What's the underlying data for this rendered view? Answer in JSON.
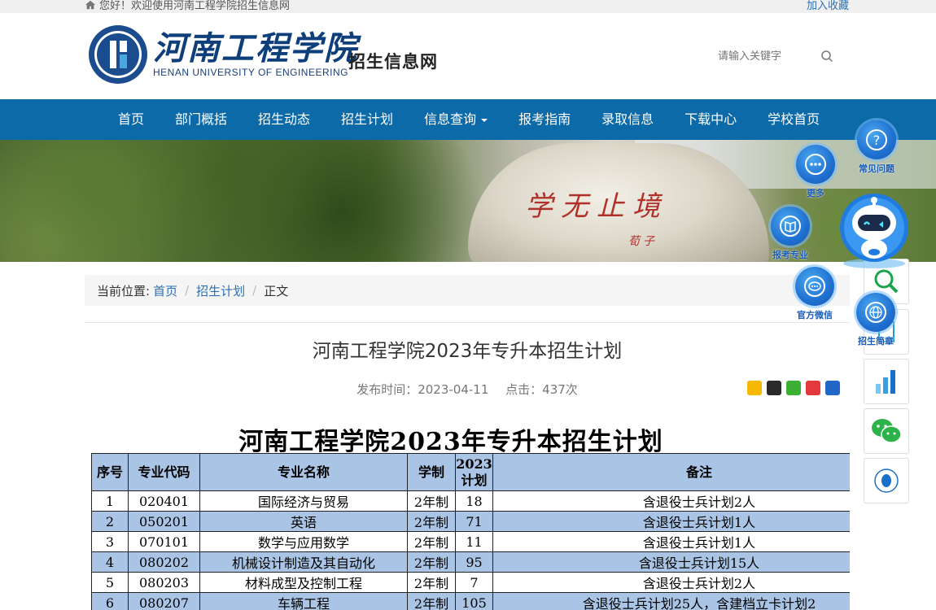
{
  "topbar": {
    "welcome": "您好！欢迎使用河南工程学院招生信息网",
    "favorite": "加入收藏"
  },
  "header": {
    "logo_cn": "河南工程学院",
    "logo_en": "HENAN UNIVERSITY OF ENGINEERING",
    "site_name": "招生信息网",
    "search_placeholder": "请输入关键字"
  },
  "nav": {
    "items": [
      "首页",
      "部门概括",
      "招生动态",
      "招生计划",
      "信息查询",
      "报考指南",
      "录取信息",
      "下载中心",
      "学校首页"
    ]
  },
  "banner": {
    "rock_text": "学无止境",
    "rock_sign": "荀子"
  },
  "breadcrumb": {
    "label": "当前位置:",
    "home": "首页",
    "category": "招生计划",
    "current": "正文"
  },
  "article": {
    "title": "河南工程学院2023年专升本招生计划",
    "publish_time": "发布时间：2023-04-11",
    "clicks": "点击：437次",
    "doc_title": "河南工程学院2023年专升本招生计划"
  },
  "table": {
    "headers": {
      "no": "序号",
      "code": "专业代码",
      "name": "专业名称",
      "system": "学制",
      "plan_year": "2023",
      "plan": "计划",
      "note": "备注"
    },
    "rows": [
      {
        "no": "1",
        "code": "020401",
        "name": "国际经济与贸易",
        "system": "2年制",
        "plan": "18",
        "note": "含退役士兵计划2人"
      },
      {
        "no": "2",
        "code": "050201",
        "name": "英语",
        "system": "2年制",
        "plan": "71",
        "note": "含退役士兵计划1人"
      },
      {
        "no": "3",
        "code": "070101",
        "name": "数学与应用数学",
        "system": "2年制",
        "plan": "11",
        "note": "含退役士兵计划1人"
      },
      {
        "no": "4",
        "code": "080202",
        "name": "机械设计制造及其自动化",
        "system": "2年制",
        "plan": "95",
        "note": "含退役士兵计划15人"
      },
      {
        "no": "5",
        "code": "080203",
        "name": "材料成型及控制工程",
        "system": "2年制",
        "plan": "7",
        "note": "含退役士兵计划2人"
      },
      {
        "no": "6",
        "code": "080207",
        "name": "车辆工程",
        "system": "2年制",
        "plan": "105",
        "note": "含退役士兵计划25人，含建档立卡计划2"
      }
    ]
  },
  "widgets": {
    "faq": "常见问题",
    "more": "更多",
    "guide": "报考专业",
    "wechat": "官方微信",
    "brochure": "招生简章"
  },
  "colors": {
    "nav": "#0c6aa8",
    "table_header": "#a9c4e4",
    "link": "#2c6fb3"
  }
}
